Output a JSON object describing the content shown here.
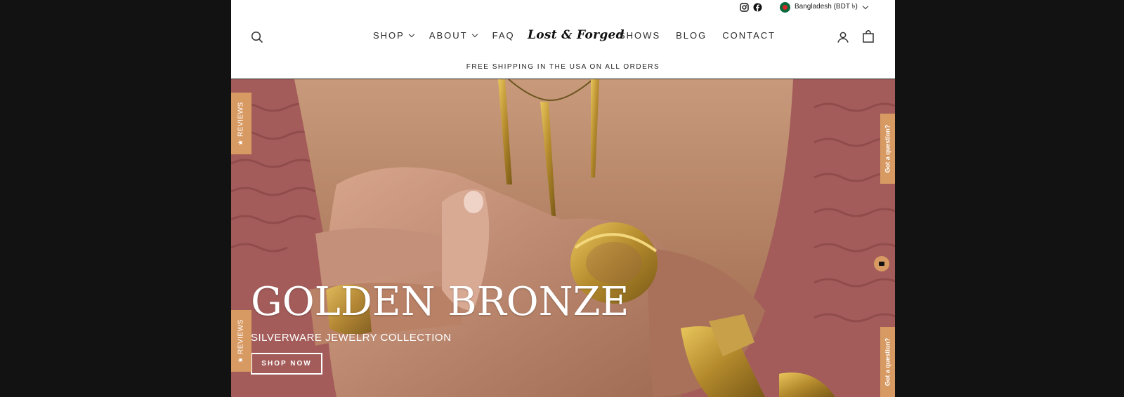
{
  "utility": {
    "social": [
      "instagram-icon",
      "facebook-icon"
    ],
    "region_label": "Bangladesh (BDT ৳)"
  },
  "nav": {
    "left": [
      {
        "label": "SHOP",
        "dropdown": true
      },
      {
        "label": "ABOUT",
        "dropdown": true
      },
      {
        "label": "FAQ",
        "dropdown": false
      }
    ],
    "right": [
      {
        "label": "SHOWS"
      },
      {
        "label": "BLOG"
      },
      {
        "label": "CONTACT"
      }
    ],
    "logo": "Lost & Forged"
  },
  "announcement": "FREE SHIPPING IN THE USA ON ALL ORDERS",
  "hero": {
    "title": "GOLDEN BRONZE",
    "subtitle": "SILVERWARE JEWELRY COLLECTION",
    "cta": "SHOP NOW"
  },
  "widgets": {
    "reviews_label": "★ REVIEWS",
    "question_label": "Got a question?"
  },
  "colors": {
    "accent": "#d89a63",
    "background": "#121212"
  }
}
